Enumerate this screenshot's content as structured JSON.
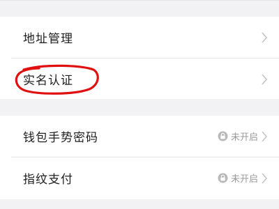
{
  "settings": {
    "group1": [
      {
        "label": "地址管理"
      },
      {
        "label": "实名认证"
      }
    ],
    "group2": [
      {
        "label": "钱包手势密码",
        "status": "未开启"
      },
      {
        "label": "指纹支付",
        "status": "未开启"
      }
    ]
  },
  "icons": {
    "chevron": "chevron-right-icon",
    "lock": "lock-icon",
    "annotation": "red-circle-annotation"
  },
  "colors": {
    "background": "#f2f2f4",
    "row": "#ffffff",
    "annotation": "#e01010",
    "status": "#9b9b9b"
  }
}
